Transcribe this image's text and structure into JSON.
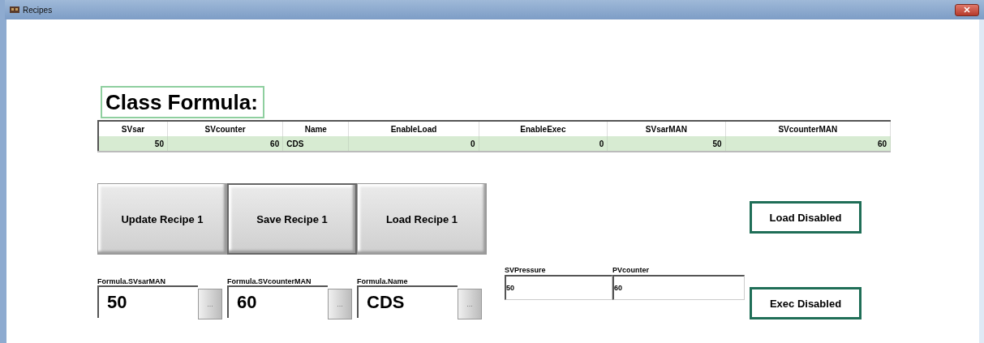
{
  "window": {
    "title": "Recipes"
  },
  "heading": "Class Formula:",
  "table": {
    "columns": [
      "SVsar",
      "SVcounter",
      "Name",
      "EnableLoad",
      "EnableExec",
      "SVsarMAN",
      "SVcounterMAN"
    ],
    "rows": [
      [
        "50",
        "60",
        "CDS",
        "0",
        "0",
        "50",
        "60"
      ]
    ]
  },
  "buttons": [
    "Update Recipe 1",
    "Save Recipe 1",
    "Load Recipe 1"
  ],
  "fields": [
    {
      "label": "Formula.SVsarMAN",
      "value": "50",
      "button": "..."
    },
    {
      "label": "Formula.SVcounterMAN",
      "value": "60",
      "button": "..."
    },
    {
      "label": "Formula.Name",
      "value": "CDS",
      "button": "..."
    }
  ],
  "process_table": {
    "columns": [
      "SVPressure",
      "PVcounter"
    ],
    "values": [
      "50",
      "60"
    ]
  },
  "status": [
    "Load Disabled",
    "Exec Disabled"
  ]
}
